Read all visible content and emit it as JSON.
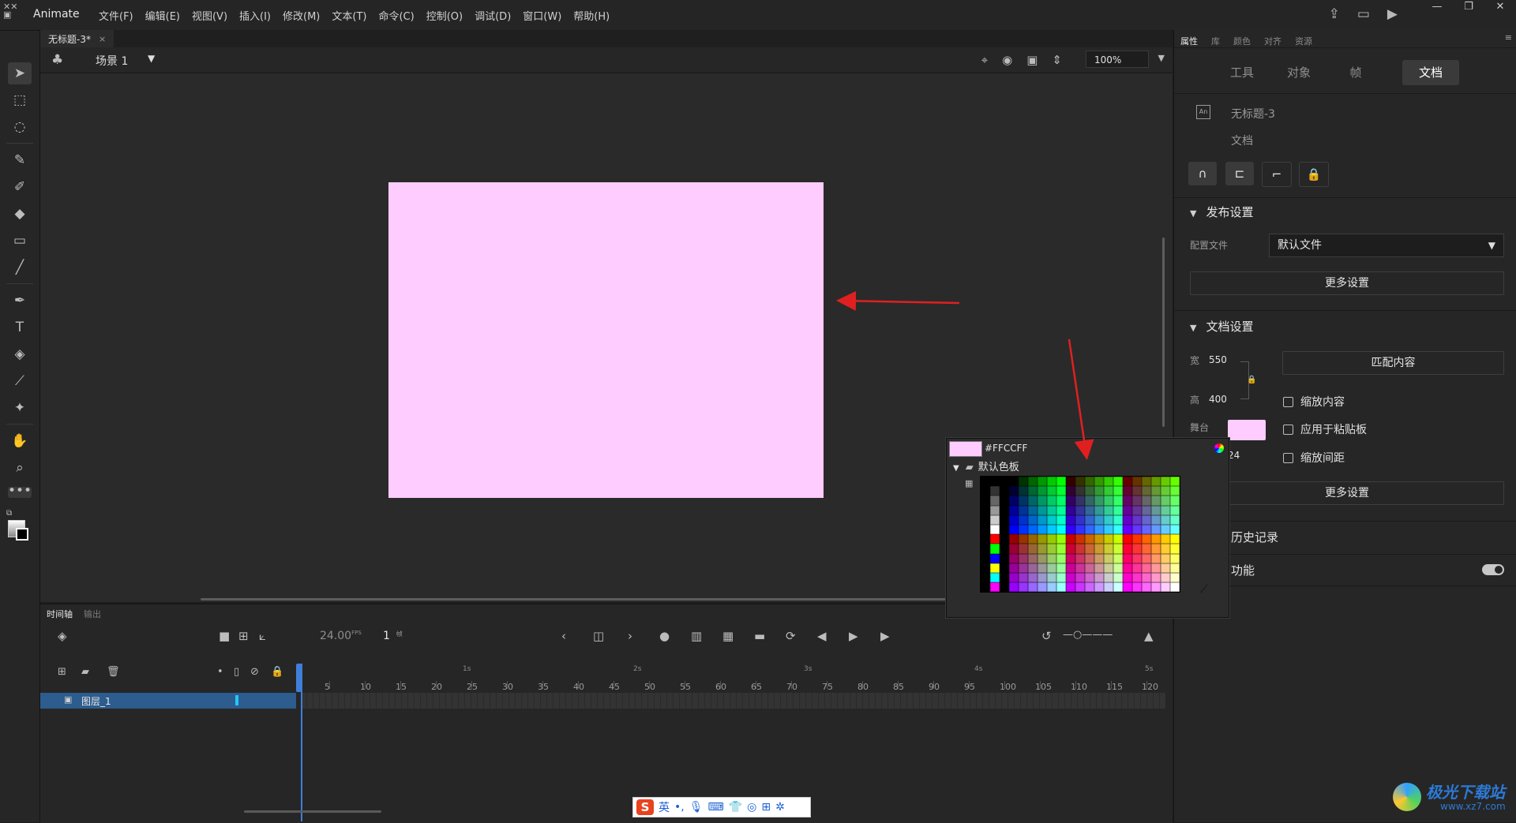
{
  "app": {
    "name": "Animate"
  },
  "menu": [
    "文件(F)",
    "编辑(E)",
    "视图(V)",
    "插入(I)",
    "修改(M)",
    "文本(T)",
    "命令(C)",
    "控制(O)",
    "调试(D)",
    "窗口(W)",
    "帮助(H)"
  ],
  "doc_tab": {
    "title": "无标题-3*",
    "close": "×"
  },
  "edit_bar": {
    "scene": "场景 1",
    "zoom": "100%"
  },
  "stage": {
    "color": "#FFCCFF"
  },
  "timeline": {
    "tabs": [
      "时间轴",
      "输出"
    ],
    "fps_value": "24.00",
    "fps_unit": "FPS",
    "current_frame": "1",
    "frame_unit": "帧",
    "layer_name": "图层_1",
    "ruler_numbers": [
      "5",
      "10",
      "15",
      "20",
      "25",
      "30",
      "35",
      "40",
      "45",
      "50",
      "55",
      "60",
      "65",
      "70",
      "75",
      "80",
      "85",
      "90",
      "95",
      "100",
      "105",
      "110",
      "115",
      "120"
    ],
    "ruler_seconds": [
      "1s",
      "2s",
      "3s",
      "4s",
      "5s"
    ]
  },
  "panel": {
    "tabs": [
      "属性",
      "库",
      "颜色",
      "对齐",
      "资源"
    ],
    "segments": [
      "工具",
      "对象",
      "帧",
      "文档"
    ],
    "active_segment": "文档",
    "doc_name": "无标题-3",
    "doc_type": "文档",
    "publish_section": "发布设置",
    "profile_label": "配置文件",
    "profile_value": "默认文件",
    "more_settings": "更多设置",
    "doc_section": "文档设置",
    "width_label": "宽",
    "width_value": "550",
    "height_label": "高",
    "height_value": "400",
    "match_content": "匹配内容",
    "scale_content": "缩放内容",
    "apply_pasteboard": "应用于粘贴板",
    "scale_spacing": "缩放间距",
    "stage_label": "舞台",
    "fps_partial": "24",
    "more_settings_2": "更多设置",
    "history": "历史记录",
    "feature": "功能"
  },
  "color_popup": {
    "hex": "#FFCCFF",
    "palette_name": "默认色板"
  },
  "ime_bar": {
    "lang": "英"
  },
  "watermark": {
    "title": "极光下载站",
    "url": "www.xz7.com"
  }
}
